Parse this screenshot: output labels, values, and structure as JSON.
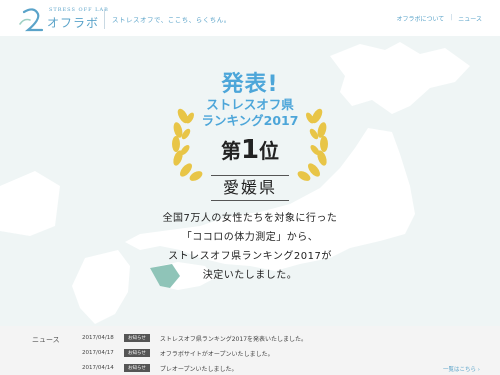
{
  "header": {
    "logo_sub": "STRESS OFF LAB",
    "logo_main": "オフラボ",
    "tagline": "ストレスオフで、ここち、らくちん。",
    "nav": [
      {
        "label": "オフラボについて"
      },
      {
        "label": "ニュース"
      }
    ],
    "nav_separator": "|"
  },
  "hero": {
    "announce": "発表!",
    "rank_title_1": "ストレスオフ県",
    "rank_title_2": "ランキング2017",
    "place_prefix": "第",
    "place_number": "1",
    "place_suffix": "位",
    "prefecture": "愛媛県",
    "message_1": "全国7万人の女性たちを対象に行った",
    "message_2": "「ココロの体力測定」から、",
    "message_3": "ストレスオフ県ランキング2017が",
    "message_4": "決定いたしました。",
    "colors": {
      "accent": "#4da6d9",
      "gold": "#e8c547",
      "map": "#ffffff",
      "highlight": "#8fc4b8"
    }
  },
  "news": {
    "heading": "ニュース",
    "items": [
      {
        "date": "2017/04/18",
        "badge": "お知らせ",
        "text": "ストレスオフ県ランキング2017を発表いたしました。"
      },
      {
        "date": "2017/04/17",
        "badge": "お知らせ",
        "text": "オフラボサイトがオープンいたしました。"
      },
      {
        "date": "2017/04/14",
        "badge": "お知らせ",
        "text": "プレオープンいたしました。"
      }
    ],
    "more": "一覧はこちら ›"
  }
}
